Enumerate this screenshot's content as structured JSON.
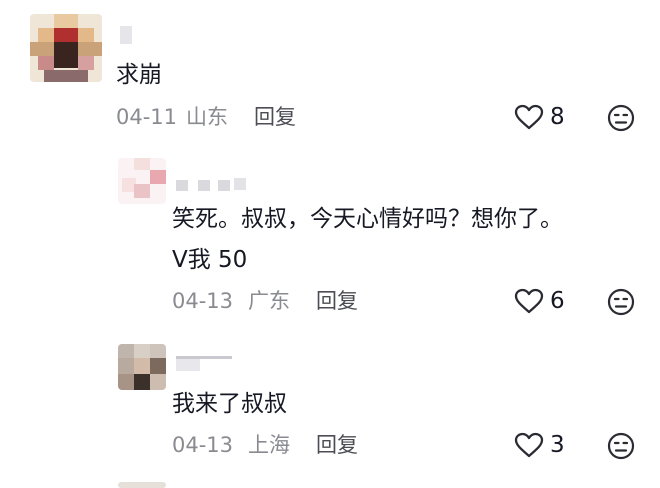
{
  "comments": [
    {
      "text_lines": [
        "求崩"
      ],
      "date": "04-11",
      "location": "山东",
      "reply_label": "回复",
      "like_count": "8",
      "like_icon": "heart-outline-icon",
      "dislike_icon": "meh-face-icon"
    },
    {
      "text_lines": [
        "笑死。叔叔，今天心情好吗？想你了。",
        "V我 50"
      ],
      "date": "04-13",
      "location": "广东",
      "reply_label": "回复",
      "like_count": "6",
      "like_icon": "heart-outline-icon",
      "dislike_icon": "meh-face-icon"
    },
    {
      "text_lines": [
        "我来了叔叔"
      ],
      "date": "04-13",
      "location": "上海",
      "reply_label": "回复",
      "like_count": "3",
      "like_icon": "heart-outline-icon",
      "dislike_icon": "meh-face-icon"
    }
  ],
  "colors": {
    "text": "#161823",
    "meta": "#8a8b91",
    "icon": "#2b2c33",
    "blurred_name": "#d9d9de"
  }
}
